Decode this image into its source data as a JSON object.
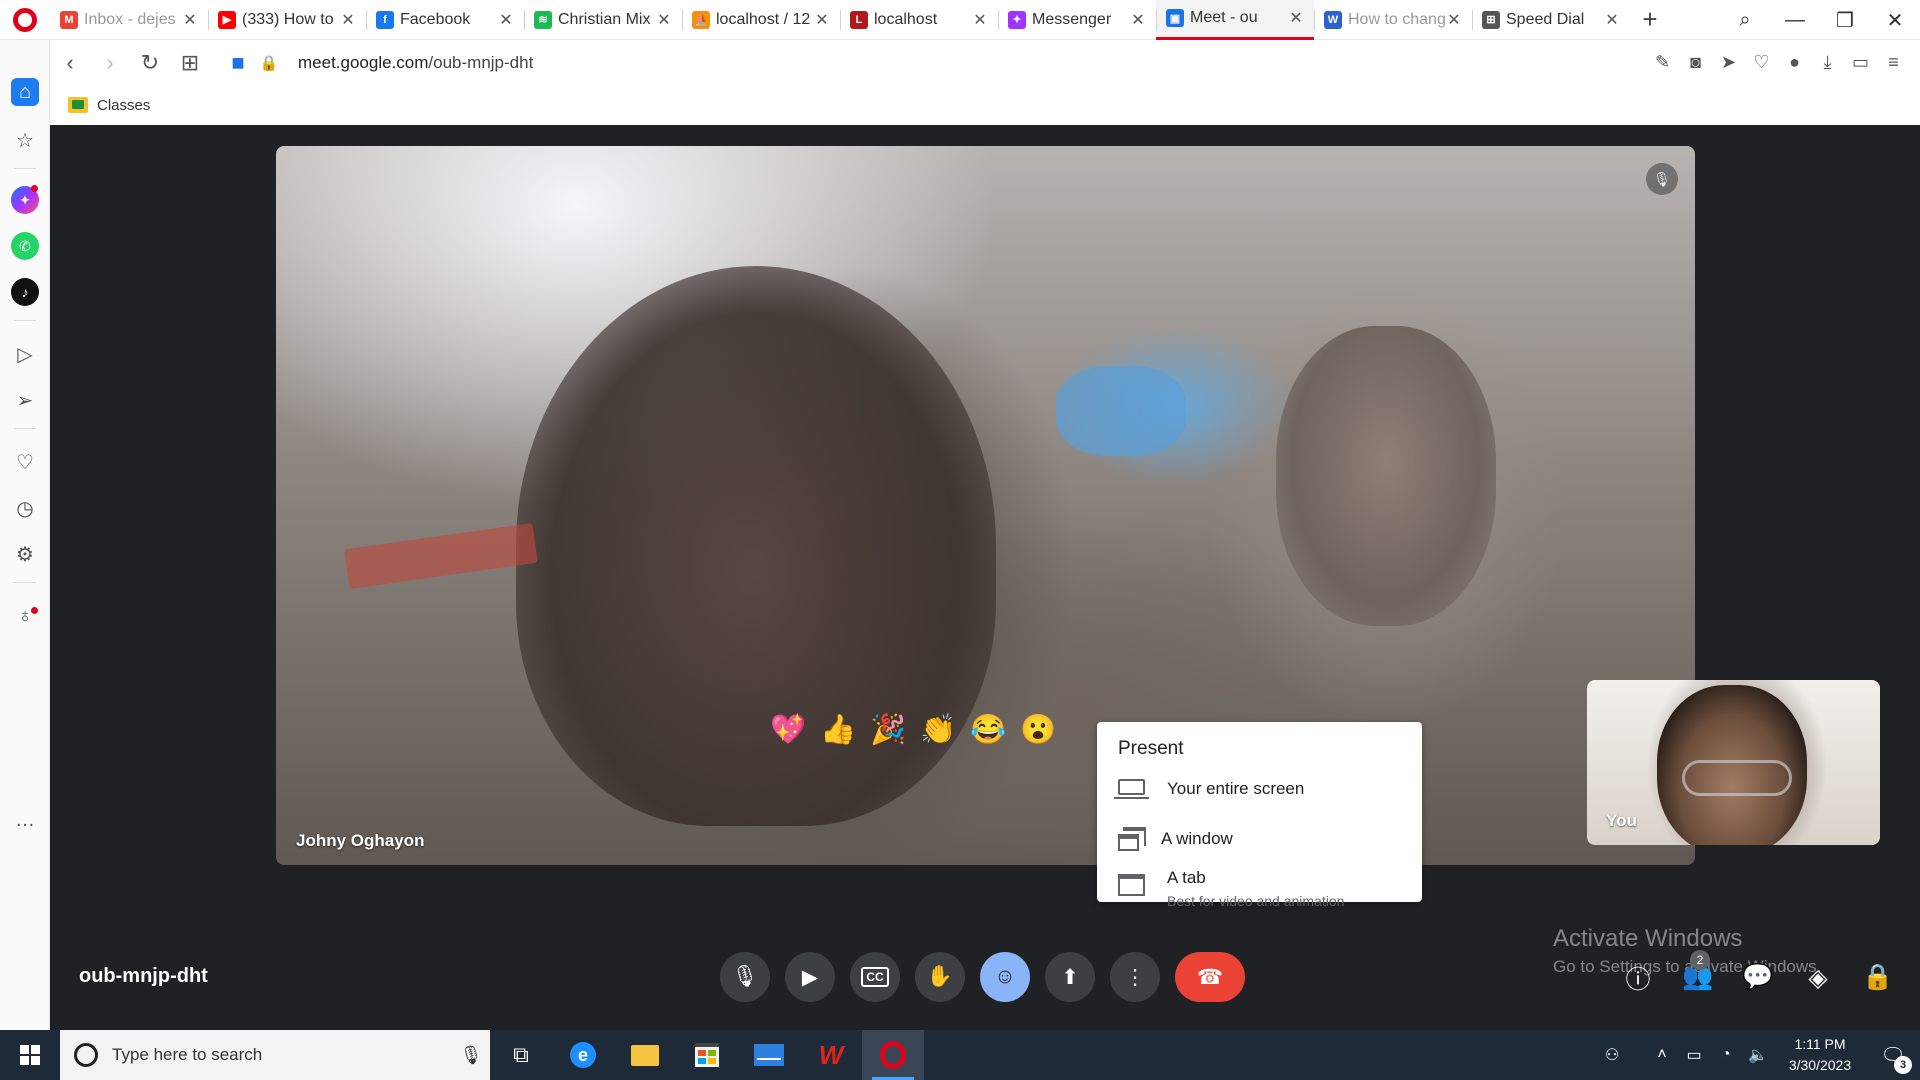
{
  "browser": {
    "tabs": [
      {
        "title": "Inbox - dejes",
        "favicon": "gmail-icon",
        "color": "#ea4335",
        "faded": true,
        "active": false
      },
      {
        "title": "(333) How to",
        "favicon": "youtube-icon",
        "color": "#ff0000",
        "faded": false,
        "active": false
      },
      {
        "title": "Facebook",
        "favicon": "facebook-icon",
        "color": "#1877f2",
        "faded": false,
        "active": false
      },
      {
        "title": "Christian Mix",
        "favicon": "spotify-icon",
        "color": "#1db954",
        "faded": false,
        "active": false
      },
      {
        "title": "localhost / 12",
        "favicon": "phpmyadmin-icon",
        "color": "#f29111",
        "faded": false,
        "active": false
      },
      {
        "title": "localhost",
        "favicon": "laravel-icon",
        "color": "#b0191e",
        "faded": false,
        "active": false
      },
      {
        "title": "Messenger",
        "favicon": "messenger-icon",
        "color": "#a033ff",
        "faded": false,
        "active": false
      },
      {
        "title": "Meet - ou",
        "favicon": "meet-icon",
        "color": "#1a73e8",
        "faded": false,
        "active": true
      },
      {
        "title": "How to chang",
        "favicon": "wordpress-icon",
        "color": "#2b61d1",
        "faded": true,
        "active": false
      },
      {
        "title": "Speed Dial",
        "favicon": "speed-dial-icon",
        "color": "#555555",
        "faded": false,
        "active": false
      }
    ],
    "url_domain": "meet.google.com",
    "url_path": "/oub-mnjp-dht",
    "bookmark": "Classes"
  },
  "meet": {
    "main_participant": "Johny Oghayon",
    "self_label": "You",
    "meeting_code": "oub-mnjp-dht",
    "participant_count": "2",
    "present_menu": {
      "title": "Present",
      "options": [
        {
          "label": "Your entire screen",
          "sub": ""
        },
        {
          "label": "A window",
          "sub": ""
        },
        {
          "label": "A tab",
          "sub": "Best for video and animation"
        }
      ]
    },
    "reactions": [
      "💖",
      "👍",
      "🎉",
      "👏",
      "😂",
      "😮"
    ]
  },
  "watermark": {
    "line1": "Activate Windows",
    "line2": "Go to Settings to activate Windows."
  },
  "taskbar": {
    "search_placeholder": "Type here to search",
    "time": "1:11 PM",
    "date": "3/30/2023",
    "notifications": "3"
  }
}
